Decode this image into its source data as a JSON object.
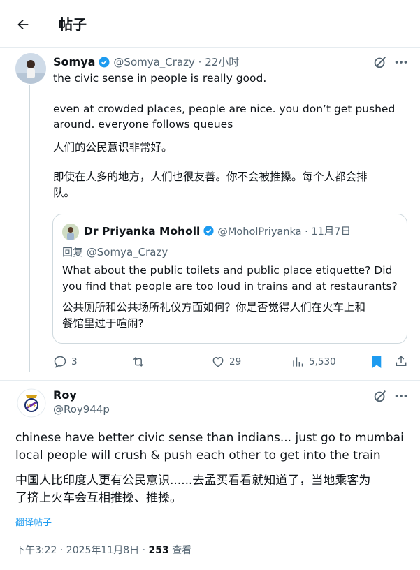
{
  "header": {
    "title": "帖子"
  },
  "reply": {
    "name": "Somya",
    "handle_time": "@Somya_Crazy · 22小时",
    "text_en_1": "the civic sense in people is really good.",
    "text_en_2a": "even at crowded places, people are nice. you don’t get pushed",
    "text_en_2b": "around. everyone follows queues",
    "text_zh_1": "人们的公民意识非常好。",
    "text_zh_2a": "即使在人多的地方，人们也很友善。你不会被推搡。每个人都会排",
    "text_zh_2b": "队。",
    "quote": {
      "name": "Dr Priyanka Moholl",
      "handle_date": "@MoholPriyanka · 11月7日",
      "reply_to": "回复 @Somya_Crazy",
      "text_en_a": "What about the public toilets and public place etiquette? Did",
      "text_en_b": "you find that people are too loud in trains and at restaurants?",
      "text_zh_a": "公共厕所和公共场所礼仪方面如何？你是否觉得人们在火车上和",
      "text_zh_b": "餐馆里过于喧闹?"
    },
    "actions": {
      "replies": "3",
      "likes": "29",
      "views": "5,530"
    }
  },
  "main": {
    "name": "Roy",
    "handle": "@Roy944p",
    "text_en_a": "chinese have better civic sense than indians... just go to mumbai",
    "text_en_b": "local people will crush & push each other to get into the train",
    "text_zh_a": "中国人比印度人更有公民意识......去孟买看看就知道了，当地乘客为",
    "text_zh_b": "了挤上火车会互相推搡、推搡。",
    "translate": "翻译帖子",
    "meta_time": "下午3:22 · 2025年11月8日 · ",
    "meta_views": "253",
    "meta_views_label": " 查看"
  },
  "colors": {
    "verified": "#1d9bf0",
    "bookmark": "#1d9bf0",
    "muted": "#536471"
  }
}
